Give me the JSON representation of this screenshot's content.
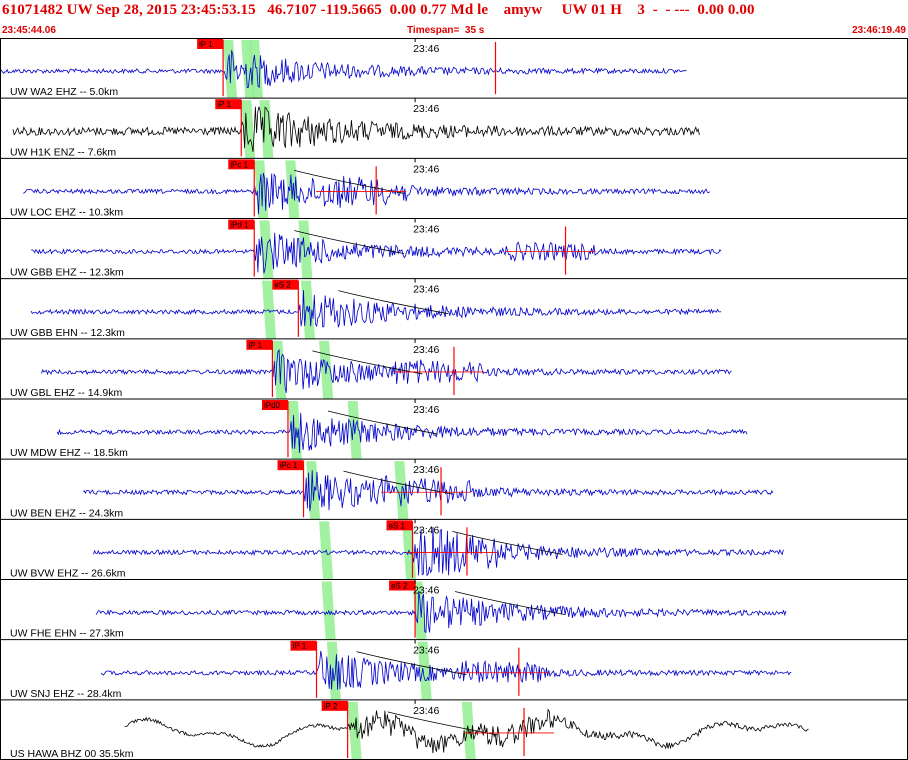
{
  "header": {
    "title": "61071482 UW Sep 28, 2015 23:45:53.15   46.7107 -119.5665  0.00 0.77 Md le    amyw     UW 01 H    3  -  - ---  0.00 0.00",
    "start_time": "23:45:44.06",
    "timespan": "Timespan=  35 s",
    "end_time": "23:46:19.49"
  },
  "colors": {
    "waveform": "#0000cc",
    "waveform_dark": "#000000",
    "pick": "#ff0000",
    "window": "#90ee90",
    "divider": "#000000"
  },
  "chart_data": {
    "type": "waveform",
    "time_range": [
      "23:45:44.06",
      "23:46:19.49"
    ],
    "tick_label": "23:46",
    "tick_time_s": 16.0,
    "timespan_s": 35,
    "traces": [
      {
        "label": "UW WA2 EHZ -- 5.0km",
        "color": "#0000cc",
        "start_s": 0.0,
        "end_s": 26.5,
        "p_pick": {
          "label": "iP 1",
          "t": 8.6
        },
        "s_pick_t": null,
        "windows": [
          8.6,
          9.3,
          9.6
        ],
        "amp": "small",
        "event_t": 8.8,
        "vline_t": 19.1
      },
      {
        "label": "UW H1K ENZ -- 7.6km",
        "color": "#000000",
        "start_s": 0.5,
        "end_s": 27.0,
        "p_pick": {
          "label": "iP 1",
          "t": 9.3
        },
        "s_pick_t": null,
        "windows": [
          9.3,
          10.0
        ],
        "amp": "big",
        "event_t": 9.5,
        "vline_t": null
      },
      {
        "label": "UW LOC EHZ -- 10.3km",
        "color": "#0000cc",
        "start_s": 0.9,
        "end_s": 27.4,
        "p_pick": {
          "label": "iPc 1",
          "t": 9.8
        },
        "s_pick_t": 14.5,
        "windows": [
          9.8,
          11.0
        ],
        "amp": "med",
        "event_t": 12.6,
        "vline_t": null
      },
      {
        "label": "UW GBB EHZ -- 12.3km",
        "color": "#0000cc",
        "start_s": 1.2,
        "end_s": 27.8,
        "p_pick": {
          "label": "iPd 1",
          "t": 9.8
        },
        "s_pick_t": 21.8,
        "windows": [
          10.0,
          11.5
        ],
        "amp": "med",
        "event_t": 12.7,
        "vline_t": null
      },
      {
        "label": "UW GBB EHN -- 12.3km",
        "color": "#0000cc",
        "start_s": 1.2,
        "end_s": 27.8,
        "p_pick": {
          "label": "eS 2",
          "t": 11.5
        },
        "s_pick_t": null,
        "windows": [
          10.1,
          11.6
        ],
        "amp": "med",
        "event_t": 12.6,
        "vline_t": null
      },
      {
        "label": "UW GBL EHZ -- 14.9km",
        "color": "#0000cc",
        "start_s": 1.6,
        "end_s": 28.2,
        "p_pick": {
          "label": "iP 1",
          "t": 10.5
        },
        "s_pick_t": 17.5,
        "windows": [
          10.5,
          12.3
        ],
        "amp": "med",
        "event_t": 13.5,
        "vline_t": null
      },
      {
        "label": "UW MDW EHZ -- 18.5km",
        "color": "#0000cc",
        "start_s": 2.2,
        "end_s": 28.8,
        "p_pick": {
          "label": "iPd0",
          "t": 11.1
        },
        "s_pick_t": null,
        "windows": [
          11.1,
          13.4
        ],
        "amp": "med",
        "event_t": 15.0,
        "vline_t": null
      },
      {
        "label": "UW BEN EHZ -- 24.3km",
        "color": "#0000cc",
        "start_s": 3.2,
        "end_s": 29.8,
        "p_pick": {
          "label": "iPc 1",
          "t": 11.7
        },
        "s_pick_t": 17.0,
        "windows": [
          11.8,
          15.2
        ],
        "amp": "med",
        "event_t": 14.0,
        "vline_t": null
      },
      {
        "label": "UW BVW EHZ -- 26.6km",
        "color": "#0000cc",
        "start_s": 3.6,
        "end_s": 30.2,
        "p_pick": {
          "label": "eS 1",
          "t": 15.9
        },
        "s_pick_t": 18.0,
        "windows": [
          12.3,
          15.5
        ],
        "amp": "med",
        "event_t": 16.5,
        "vline_t": null
      },
      {
        "label": "UW FHE EHN -- 27.3km",
        "color": "#0000cc",
        "start_s": 3.7,
        "end_s": 30.3,
        "p_pick": {
          "label": "eS 2",
          "t": 16.0
        },
        "s_pick_t": null,
        "windows": [
          12.4,
          15.9
        ],
        "amp": "med",
        "event_t": 16.6,
        "vline_t": null
      },
      {
        "label": "UW SNJ EHZ -- 28.4km",
        "color": "#0000cc",
        "start_s": 3.9,
        "end_s": 30.5,
        "p_pick": {
          "label": "iP 1",
          "t": 12.2
        },
        "s_pick_t": 20.0,
        "windows": [
          12.6,
          16.1
        ],
        "amp": "med",
        "event_t": 18.5,
        "vline_t": null
      },
      {
        "label": "US HAWA BHZ 00 35.5km",
        "color": "#000000",
        "start_s": 4.8,
        "end_s": 31.2,
        "p_pick": {
          "label": "iP 2",
          "t": 13.4
        },
        "s_pick_t": 20.2,
        "windows": [
          13.4,
          17.8
        ],
        "amp": "long",
        "event_t": 20.2,
        "vline_t": null
      }
    ]
  }
}
